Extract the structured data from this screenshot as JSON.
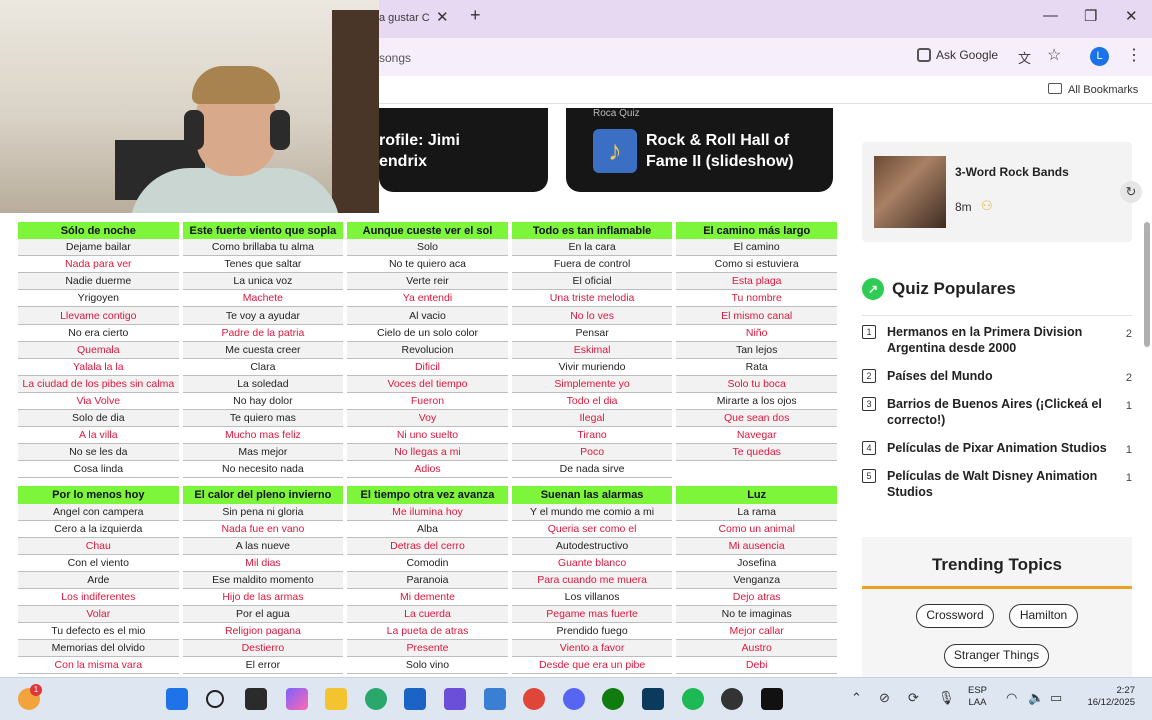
{
  "browser": {
    "tab_title": "a gustar C",
    "url_text": "songs",
    "ask_google": "Ask Google",
    "profile_initial": "L",
    "all_bookmarks": "All Bookmarks"
  },
  "cards": {
    "left_title_line1": "rofile: Jimi",
    "left_title_line2": "endrix",
    "right_category": "Roca Quiz",
    "right_title_line1": "Rock & Roll Hall of",
    "right_title_line2": "Fame II (slideshow)"
  },
  "lyrics_table": {
    "block1": {
      "headers": [
        "Sólo de noche",
        "Este fuerte viento que sopla",
        "Aunque cueste ver el sol",
        "Todo es tan inflamable",
        "El camino más largo"
      ],
      "rows": [
        [
          {
            "t": "Dejame bailar",
            "c": "blk"
          },
          {
            "t": "Como brillaba tu alma",
            "c": "blk"
          },
          {
            "t": "Solo",
            "c": "blk"
          },
          {
            "t": "En la cara",
            "c": "blk"
          },
          {
            "t": "El camino",
            "c": "blk"
          }
        ],
        [
          {
            "t": "Nada para ver",
            "c": "red"
          },
          {
            "t": "Tenes que saltar",
            "c": "blk"
          },
          {
            "t": "No te quiero aca",
            "c": "blk"
          },
          {
            "t": "Fuera de control",
            "c": "blk"
          },
          {
            "t": "Como si estuviera",
            "c": "blk"
          }
        ],
        [
          {
            "t": "Nadie duerme",
            "c": "blk"
          },
          {
            "t": "La unica voz",
            "c": "blk"
          },
          {
            "t": "Verte reir",
            "c": "blk"
          },
          {
            "t": "El oficial",
            "c": "blk"
          },
          {
            "t": "Esta plaga",
            "c": "red"
          }
        ],
        [
          {
            "t": "Yrigoyen",
            "c": "blk"
          },
          {
            "t": "Machete",
            "c": "red"
          },
          {
            "t": "Ya entendi",
            "c": "red"
          },
          {
            "t": "Una triste melodia",
            "c": "red"
          },
          {
            "t": "Tu nombre",
            "c": "red"
          }
        ],
        [
          {
            "t": "Llevame contigo",
            "c": "red"
          },
          {
            "t": "Te voy a ayudar",
            "c": "blk"
          },
          {
            "t": "Al vacio",
            "c": "blk"
          },
          {
            "t": "No lo ves",
            "c": "red"
          },
          {
            "t": "El mismo canal",
            "c": "red"
          }
        ],
        [
          {
            "t": "No era cierto",
            "c": "blk"
          },
          {
            "t": "Padre de la patria",
            "c": "red"
          },
          {
            "t": "Cielo de un solo color",
            "c": "blk"
          },
          {
            "t": "Pensar",
            "c": "blk"
          },
          {
            "t": "Niño",
            "c": "red"
          }
        ],
        [
          {
            "t": "Quemala",
            "c": "red"
          },
          {
            "t": "Me cuesta creer",
            "c": "blk"
          },
          {
            "t": "Revolucion",
            "c": "blk"
          },
          {
            "t": "Eskimal",
            "c": "red"
          },
          {
            "t": "Tan lejos",
            "c": "blk"
          }
        ],
        [
          {
            "t": "Yalala la la",
            "c": "red"
          },
          {
            "t": "Clara",
            "c": "blk"
          },
          {
            "t": "Dificil",
            "c": "red"
          },
          {
            "t": "Vivir muriendo",
            "c": "blk"
          },
          {
            "t": "Rata",
            "c": "blk"
          }
        ],
        [
          {
            "t": "La ciudad de los pibes sin calma",
            "c": "red"
          },
          {
            "t": "La soledad",
            "c": "blk"
          },
          {
            "t": "Voces del tiempo",
            "c": "red"
          },
          {
            "t": "Simplemente yo",
            "c": "red"
          },
          {
            "t": "Solo tu boca",
            "c": "red"
          }
        ],
        [
          {
            "t": "Via Volve",
            "c": "red"
          },
          {
            "t": "No hay dolor",
            "c": "blk"
          },
          {
            "t": "Fueron",
            "c": "red"
          },
          {
            "t": "Todo el dia",
            "c": "red"
          },
          {
            "t": "Mirarte a los ojos",
            "c": "blk"
          }
        ],
        [
          {
            "t": "Solo de dia",
            "c": "blk"
          },
          {
            "t": "Te quiero mas",
            "c": "blk"
          },
          {
            "t": "Voy",
            "c": "red"
          },
          {
            "t": "Ilegal",
            "c": "red"
          },
          {
            "t": "Que sean dos",
            "c": "red"
          }
        ],
        [
          {
            "t": "A la villa",
            "c": "red"
          },
          {
            "t": "Mucho mas feliz",
            "c": "red"
          },
          {
            "t": "Ni uno suelto",
            "c": "red"
          },
          {
            "t": "Tirano",
            "c": "red"
          },
          {
            "t": "Navegar",
            "c": "red"
          }
        ],
        [
          {
            "t": "No se les da",
            "c": "blk"
          },
          {
            "t": "Mas mejor",
            "c": "blk"
          },
          {
            "t": "No llegas a mi",
            "c": "red"
          },
          {
            "t": "Poco",
            "c": "red"
          },
          {
            "t": "Te quedas",
            "c": "red"
          }
        ],
        [
          {
            "t": "Cosa linda",
            "c": "blk"
          },
          {
            "t": "No necesito nada",
            "c": "blk"
          },
          {
            "t": "Adios",
            "c": "red"
          },
          {
            "t": "De nada sirve",
            "c": "blk"
          },
          {
            "t": "",
            "c": "empty"
          }
        ]
      ]
    },
    "block2": {
      "headers": [
        "Por lo menos hoy",
        "El calor del pleno invierno",
        "El tiempo otra vez avanza",
        "Suenan las alarmas",
        "Luz"
      ],
      "rows": [
        [
          {
            "t": "Angel con campera",
            "c": "blk"
          },
          {
            "t": "Sin pena ni gloria",
            "c": "blk"
          },
          {
            "t": "Me ilumina hoy",
            "c": "red"
          },
          {
            "t": "Y el mundo me comio a mi",
            "c": "blk"
          },
          {
            "t": "La rama",
            "c": "blk"
          }
        ],
        [
          {
            "t": "Cero a la izquierda",
            "c": "blk"
          },
          {
            "t": "Nada fue en vano",
            "c": "red"
          },
          {
            "t": "Alba",
            "c": "blk"
          },
          {
            "t": "Queria ser como el",
            "c": "red"
          },
          {
            "t": "Como un animal",
            "c": "red"
          }
        ],
        [
          {
            "t": "Chau",
            "c": "red"
          },
          {
            "t": "A las nueve",
            "c": "blk"
          },
          {
            "t": "Detras del cerro",
            "c": "red"
          },
          {
            "t": "Autodestructivo",
            "c": "blk"
          },
          {
            "t": "Mi ausencia",
            "c": "red"
          }
        ],
        [
          {
            "t": "Con el viento",
            "c": "blk"
          },
          {
            "t": "Mil dias",
            "c": "red"
          },
          {
            "t": "Comodin",
            "c": "blk"
          },
          {
            "t": "Guante blanco",
            "c": "red"
          },
          {
            "t": "Josefina",
            "c": "blk"
          }
        ],
        [
          {
            "t": "Arde",
            "c": "blk"
          },
          {
            "t": "Ese maldito momento",
            "c": "blk"
          },
          {
            "t": "Paranoia",
            "c": "blk"
          },
          {
            "t": "Para cuando me muera",
            "c": "red"
          },
          {
            "t": "Venganza",
            "c": "blk"
          }
        ],
        [
          {
            "t": "Los indiferentes",
            "c": "red"
          },
          {
            "t": "Hijo de las armas",
            "c": "red"
          },
          {
            "t": "Mi demente",
            "c": "red"
          },
          {
            "t": "Los villanos",
            "c": "blk"
          },
          {
            "t": "Dejo atras",
            "c": "red"
          }
        ],
        [
          {
            "t": "Volar",
            "c": "red"
          },
          {
            "t": "Por el agua",
            "c": "blk"
          },
          {
            "t": "La cuerda",
            "c": "red"
          },
          {
            "t": "Pegame mas fuerte",
            "c": "red"
          },
          {
            "t": "No te imaginas",
            "c": "blk"
          }
        ],
        [
          {
            "t": "Tu defecto es el mio",
            "c": "blk"
          },
          {
            "t": "Religion pagana",
            "c": "red"
          },
          {
            "t": "La pueta de atras",
            "c": "red"
          },
          {
            "t": "Prendido fuego",
            "c": "blk"
          },
          {
            "t": "Mejor callar",
            "c": "red"
          }
        ],
        [
          {
            "t": "Memorias del olvido",
            "c": "blk"
          },
          {
            "t": "Destierro",
            "c": "red"
          },
          {
            "t": "Presente",
            "c": "red"
          },
          {
            "t": "Viento a favor",
            "c": "red"
          },
          {
            "t": "Austro",
            "c": "red"
          }
        ],
        [
          {
            "t": "Con la misma vara",
            "c": "red"
          },
          {
            "t": "El error",
            "c": "blk"
          },
          {
            "t": "Solo vino",
            "c": "blk"
          },
          {
            "t": "Desde que era un pibe",
            "c": "red"
          },
          {
            "t": "Debi",
            "c": "red"
          }
        ]
      ]
    }
  },
  "sidebar": {
    "featured_title": "3-Word Rock Bands",
    "featured_time": "8m",
    "popular_heading": "Quiz Populares",
    "popular": [
      {
        "num": "1",
        "label": "Hermanos en la Primera Division Argentina desde 2000",
        "count": "2"
      },
      {
        "num": "2",
        "label": "Países del Mundo",
        "count": "2"
      },
      {
        "num": "3",
        "label": "Barrios de Buenos Aires (¡Clickeá el correcto!)",
        "count": "1"
      },
      {
        "num": "4",
        "label": "Películas de Pixar Animation Studios",
        "count": "1"
      },
      {
        "num": "5",
        "label": "Películas de Walt Disney Animation Studios",
        "count": "1"
      }
    ],
    "trending_title": "Trending Topics",
    "topics": [
      "Crossword",
      "Hamilton",
      "Stranger Things"
    ]
  },
  "taskbar": {
    "weather_badge": "1",
    "lang_line1": "ESP",
    "lang_line2": "LAA",
    "time": "2:27",
    "date": "16/12/2025"
  }
}
